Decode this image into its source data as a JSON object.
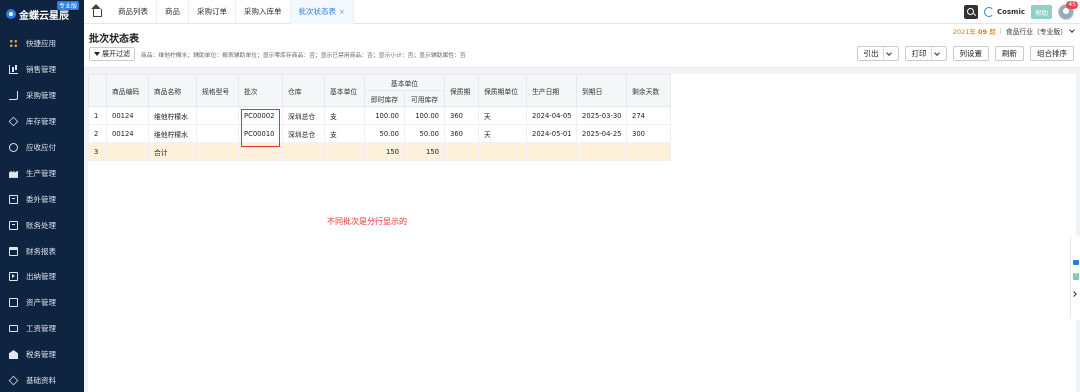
{
  "brand": {
    "name": "金蝶云星辰",
    "badge": "专业版"
  },
  "sidebar": {
    "items": [
      {
        "label": "快捷应用",
        "icon": "apps-grid-icon"
      },
      {
        "label": "销售管理",
        "icon": "sales-chart-icon"
      },
      {
        "label": "采购管理",
        "icon": "cart-icon"
      },
      {
        "label": "库存管理",
        "icon": "inventory-cube-icon"
      },
      {
        "label": "应收应付",
        "icon": "receivable-icon"
      },
      {
        "label": "生产管理",
        "icon": "factory-icon"
      },
      {
        "label": "委外管理",
        "icon": "outsource-doc-icon"
      },
      {
        "label": "账务处理",
        "icon": "ledger-icon"
      },
      {
        "label": "财务报表",
        "icon": "report-icon"
      },
      {
        "label": "出纳管理",
        "icon": "cashier-icon"
      },
      {
        "label": "资产管理",
        "icon": "asset-icon"
      },
      {
        "label": "工资管理",
        "icon": "payroll-icon"
      },
      {
        "label": "税务管理",
        "icon": "tax-icon"
      },
      {
        "label": "基础资料",
        "icon": "base-data-icon"
      }
    ]
  },
  "tabs": [
    {
      "label": "商品列表"
    },
    {
      "label": "商品"
    },
    {
      "label": "采购订单"
    },
    {
      "label": "采购入库单"
    },
    {
      "label": "批次状态表",
      "active": true,
      "close": "×"
    }
  ],
  "topright": {
    "cosmic": "Cosmic",
    "help": "帮助",
    "badge": "45"
  },
  "header": {
    "title": "批次状态表",
    "filter_button": "展开过滤",
    "filter_summary": "商品：维他柠檬水；辅助单位：报表辅助单位；显示零库存商品：否；显示已禁用商品：否；显示小计：否；显示辅助属性：否",
    "period_prefix": "2021年",
    "period_value": "09",
    "period_suffix": "期",
    "separator": "|",
    "industry": "食品行业（专业版）"
  },
  "actions": {
    "export": "引出",
    "print": "打印",
    "columns": "列设置",
    "refresh": "刷新",
    "sort": "组合排序"
  },
  "table": {
    "headers": {
      "code": "商品编码",
      "name": "商品名称",
      "spec": "规格型号",
      "batch": "批次",
      "warehouse": "仓库",
      "base_unit": "基本单位",
      "group_base_unit": "基本单位",
      "instant_stock": "即时库存",
      "available_stock": "可用库存",
      "shelf_life": "保质期",
      "shelf_life_unit": "保质期单位",
      "production_date": "生产日期",
      "expiry_date": "到期日",
      "remaining_days": "剩余天数"
    },
    "rows": [
      {
        "seq": "1",
        "code": "00124",
        "name": "维他柠檬水",
        "spec": "",
        "batch": "PC00002",
        "warehouse": "深圳总仓",
        "unit": "支",
        "instant": "100.00",
        "available": "100.00",
        "shelf_life": "360",
        "shelf_unit": "天",
        "prod_date": "2024-04-05",
        "expiry": "2025-03-30",
        "remaining": "274"
      },
      {
        "seq": "2",
        "code": "00124",
        "name": "维他柠檬水",
        "spec": "",
        "batch": "PC00010",
        "warehouse": "深圳总仓",
        "unit": "支",
        "instant": "50.00",
        "available": "50.00",
        "shelf_life": "360",
        "shelf_unit": "天",
        "prod_date": "2024-05-01",
        "expiry": "2025-04-25",
        "remaining": "300"
      }
    ],
    "total": {
      "seq": "3",
      "label": "合计",
      "instant": "150",
      "available": "150"
    }
  },
  "annotation": "不同批次是分行显示的",
  "colors": {
    "sidebar_bg": "#0f2440",
    "accent": "#2a7ee0",
    "total_row": "#fdf1dc",
    "annotation": "#e03333",
    "period": "#d77b00"
  }
}
